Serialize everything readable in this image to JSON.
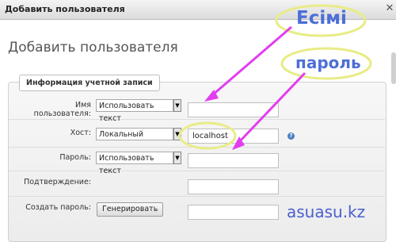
{
  "window": {
    "title": "Добавить пользователя",
    "close_glyph": "✕"
  },
  "page_title": "Добавить пользователя",
  "fieldset_legend": "Информация учетной записи",
  "form": {
    "username": {
      "label": "Имя пользователя:",
      "select": "Использовать текст",
      "value": ""
    },
    "host": {
      "label": "Хост:",
      "select": "Локальный",
      "value": "localhost",
      "help_glyph": "?"
    },
    "password": {
      "label": "Пароль:",
      "select": "Использовать текст",
      "value": ""
    },
    "confirm": {
      "label": "Подтверждение:",
      "value": ""
    },
    "generate": {
      "label": "Создать пароль:",
      "button": "Генерировать",
      "value": ""
    }
  },
  "annotations": {
    "username_note": "Есімі",
    "password_note": "пароль",
    "highlight_color": "#e8ec86",
    "arrow_color": "#e23df0"
  },
  "watermark": "asuasu.kz",
  "colors": {
    "titlebar": "#dcdcdc",
    "help_icon": "#4a7fc1"
  }
}
